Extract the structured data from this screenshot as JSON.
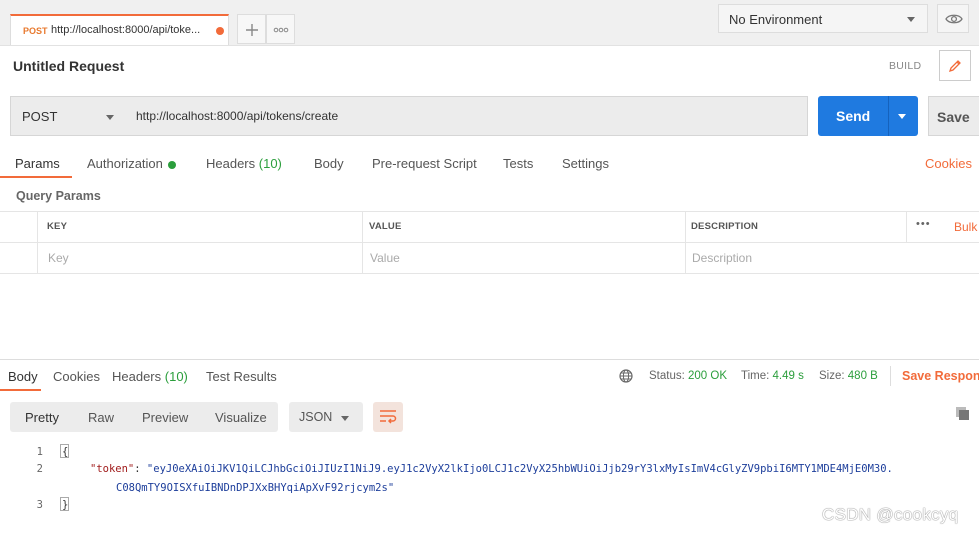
{
  "tabbar": {
    "request_tab": {
      "method": "POST",
      "url": "http://localhost:8000/api/toke..."
    },
    "add_tab_icon": "plus-icon",
    "more_tabs_icon": "ellipsis-icon",
    "environment": "No Environment",
    "eye_icon": "eye-icon"
  },
  "request": {
    "title": "Untitled Request",
    "build_label": "BUILD",
    "method": "POST",
    "url": "http://localhost:8000/api/tokens/create",
    "send_label": "Send",
    "save_label": "Save"
  },
  "request_tabs": {
    "params": "Params",
    "authorization": "Authorization",
    "headers": "Headers",
    "headers_count": "(10)",
    "body": "Body",
    "prerequest": "Pre-request Script",
    "tests": "Tests",
    "settings": "Settings",
    "cookies": "Cookies"
  },
  "params": {
    "section_title": "Query Params",
    "columns": {
      "key": "KEY",
      "value": "VALUE",
      "description": "DESCRIPTION"
    },
    "more": "•••",
    "bulk": "Bulk",
    "placeholders": {
      "key": "Key",
      "value": "Value",
      "description": "Description"
    }
  },
  "response": {
    "tabs": {
      "body": "Body",
      "cookies": "Cookies",
      "headers": "Headers",
      "headers_count": "(10)",
      "test_results": "Test Results"
    },
    "status_label": "Status:",
    "status": "200 OK",
    "time_label": "Time:",
    "time": "4.49 s",
    "size_label": "Size:",
    "size": "480 B",
    "save_response": "Save Respons",
    "view_modes": [
      "Pretty",
      "Raw",
      "Preview",
      "Visualize"
    ],
    "format": "JSON",
    "code": {
      "line_numbers": [
        "1",
        "2",
        "3"
      ],
      "open_brace": "{",
      "key": "\"token\"",
      "colon": ": ",
      "value_line1": "\"eyJ0eXAiOiJKV1QiLCJhbGciOiJIUzI1NiJ9.eyJ1c2VyX2lkIjo0LCJ1c2VyX25hbWUiOiJjb29rY3lxMyIsImV4cGlyZV9pbiI6MTY1MDE4MjE0M30.",
      "value_line2": "C08QmTY9OISXfuIBNDnDPJXxBHYqiApXvF92rjcym2s\"",
      "close_brace": "}"
    }
  },
  "watermark": "CSDN @cookcyq",
  "colors": {
    "accent": "#f26b3a",
    "send": "#1f7ae0",
    "success": "#2b9e3c"
  }
}
